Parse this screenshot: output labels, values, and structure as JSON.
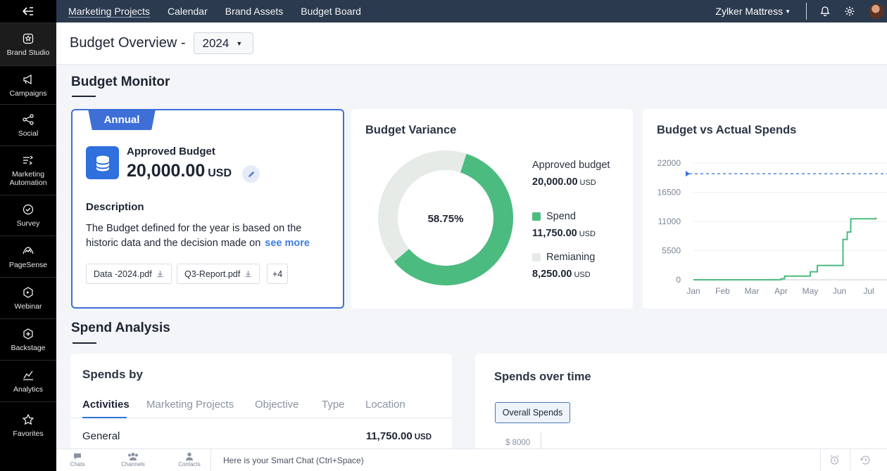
{
  "sidebar": {
    "items": [
      {
        "label": "Brand Studio",
        "icon": "brand-studio-icon",
        "active": true
      },
      {
        "label": "Campaigns",
        "icon": "megaphone-icon"
      },
      {
        "label": "Social",
        "icon": "share-icon"
      },
      {
        "label": "Marketing Automation",
        "icon": "automation-icon"
      },
      {
        "label": "Survey",
        "icon": "survey-icon"
      },
      {
        "label": "PageSense",
        "icon": "pagesense-icon"
      },
      {
        "label": "Webinar",
        "icon": "webinar-icon"
      },
      {
        "label": "Backstage",
        "icon": "backstage-icon"
      },
      {
        "label": "Analytics",
        "icon": "analytics-icon"
      },
      {
        "label": "Favorites",
        "icon": "star-icon"
      }
    ]
  },
  "topnav": {
    "tabs": [
      "Marketing Projects",
      "Calendar",
      "Brand Assets",
      "Budget Board"
    ],
    "org_name": "Zylker Mattress"
  },
  "header": {
    "title": "Budget Overview -",
    "year": "2024"
  },
  "budget_monitor": {
    "title": "Budget Monitor",
    "annual": {
      "tab_label": "Annual",
      "approved_label": "Approved Budget",
      "approved_value": "20,000.00",
      "currency": "USD",
      "description_label": "Description",
      "description_text": "The Budget defined for the year is based on the historic data and the decision made on",
      "see_more": "see more",
      "attachments": [
        "Data -2024.pdf",
        "Q3-Report.pdf"
      ],
      "more_count": "+4"
    },
    "variance": {
      "title": "Budget Variance",
      "center_pct": "58.75%",
      "spend_fraction": 0.5875,
      "approved_label": "Approved budget",
      "approved_value": "20,000.00",
      "spend_label": "Spend",
      "spend_value": "11,750.00",
      "remaining_label": "Remianing",
      "remaining_value": "8,250.00",
      "currency": "USD",
      "colors": {
        "spend": "#4cbb7f",
        "remaining": "#e6ebe8"
      }
    },
    "bva": {
      "title": "Budget vs Actual Spends"
    }
  },
  "chart_data": {
    "type": "line",
    "title": "Budget vs Actual Spends",
    "x": [
      "Jan",
      "Feb",
      "Mar",
      "Apr",
      "May",
      "Jun",
      "Jul"
    ],
    "y_ticks": [
      0,
      5500,
      11000,
      16500,
      22000
    ],
    "ylim": [
      0,
      22000
    ],
    "budget_line": 20000,
    "series": [
      {
        "points": [
          [
            "Jan",
            0
          ],
          [
            "Apr",
            0
          ],
          [
            "Apr",
            200
          ],
          [
            "Apr",
            700
          ],
          [
            "May",
            700
          ],
          [
            "May",
            1500
          ],
          [
            "May",
            2700
          ],
          [
            "Jun",
            2700
          ],
          [
            "Jun",
            7600
          ],
          [
            "Jun",
            9000
          ],
          [
            "Jun",
            10000
          ],
          [
            "Jun",
            11500
          ],
          [
            "Jul",
            11750
          ]
        ],
        "color": "#4cbb7f"
      }
    ],
    "budget_color": "#2f6fde",
    "grid": true
  },
  "spend_analysis": {
    "title": "Spend Analysis",
    "spends_by": {
      "title": "Spends by",
      "tabs": [
        "Activities",
        "Marketing Projects",
        "Objective",
        "Type",
        "Location"
      ],
      "rows": [
        {
          "label": "General",
          "value": "11,750.00",
          "currency": "USD"
        }
      ]
    },
    "spends_over_time": {
      "title": "Spends over time",
      "button": "Overall Spends",
      "axis_label": "$ 8000"
    }
  },
  "bottombar": {
    "items": [
      "Chats",
      "Channels",
      "Contacts"
    ],
    "smart_chat": "Here is your Smart Chat (Ctrl+Space)"
  }
}
